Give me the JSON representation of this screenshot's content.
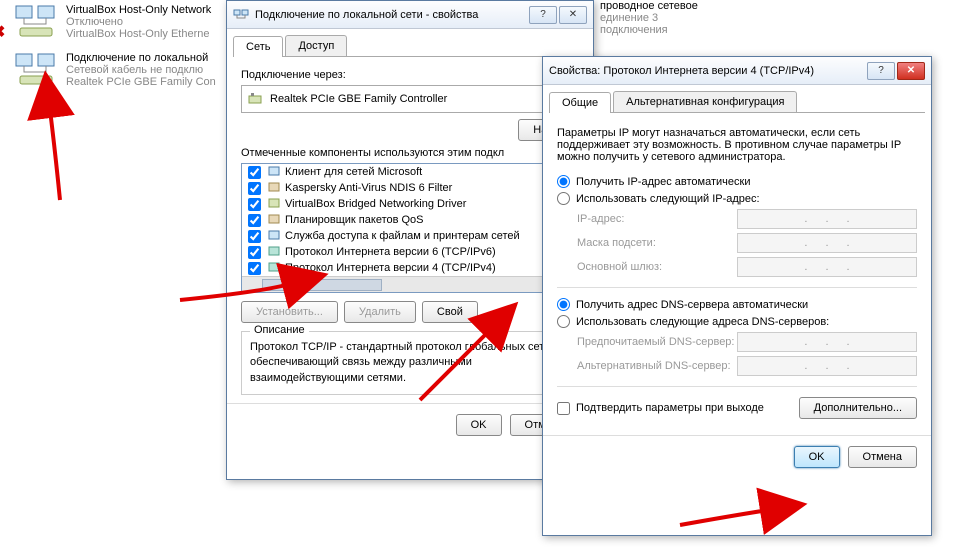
{
  "network_panel": {
    "items": [
      {
        "title": "VirtualBox Host-Only Network",
        "status": "Отключено",
        "adapter": "VirtualBox Host-Only Etherne"
      },
      {
        "title": "Подключение по локальной",
        "status": "Сетевой кабель не подклю",
        "adapter": "Realtek PCIe GBE Family Con"
      }
    ],
    "wireless": {
      "title": "проводное сетевое",
      "sub": "единение 3",
      "status": "подключения"
    }
  },
  "dialog1": {
    "title": "Подключение по локальной сети - свойства",
    "tabs": [
      "Сеть",
      "Доступ"
    ],
    "connect_via_label": "Подключение через:",
    "adapter": "Realtek PCIe GBE Family Controller",
    "configure_btn": "Настр",
    "components_label": "Отмеченные компоненты используются этим подкл",
    "components": [
      {
        "label": "Клиент для сетей Microsoft",
        "checked": true
      },
      {
        "label": "Kaspersky Anti-Virus NDIS 6 Filter",
        "checked": true
      },
      {
        "label": "VirtualBox Bridged Networking Driver",
        "checked": true
      },
      {
        "label": "Планировщик пакетов QoS",
        "checked": true
      },
      {
        "label": "Служба доступа к файлам и принтерам сетей",
        "checked": true
      },
      {
        "label": "Протокол Интернета версии 6 (TCP/IPv6)",
        "checked": true
      },
      {
        "label": "Протокол Интернета версии 4 (TCP/IPv4)",
        "checked": true
      }
    ],
    "install_btn": "Установить...",
    "remove_btn": "Удалить",
    "props_btn": "Свой",
    "desc_legend": "Описание",
    "desc_text": "Протокол TCP/IP - стандартный протокол глобальных сетей, обеспечивающий связь между различными взаимодействующими сетями.",
    "ok": "OK",
    "cancel": "Отмена"
  },
  "dialog2": {
    "title": "Свойства: Протокол Интернета версии 4 (TCP/IPv4)",
    "tabs": [
      "Общие",
      "Альтернативная конфигурация"
    ],
    "info": "Параметры IP могут назначаться автоматически, если сеть поддерживает эту возможность. В противном случае параметры IP можно получить у сетевого администратора.",
    "ip_auto": "Получить IP-адрес автоматически",
    "ip_manual": "Использовать следующий IP-адрес:",
    "fields_ip": [
      "IP-адрес:",
      "Маска подсети:",
      "Основной шлюз:"
    ],
    "dns_auto": "Получить адрес DNS-сервера автоматически",
    "dns_manual": "Использовать следующие адреса DNS-серверов:",
    "fields_dns": [
      "Предпочитаемый DNS-сервер:",
      "Альтернативный DNS-сервер:"
    ],
    "confirm_exit": "Подтвердить параметры при выходе",
    "advanced": "Дополнительно...",
    "ok": "OK",
    "cancel": "Отмена"
  }
}
